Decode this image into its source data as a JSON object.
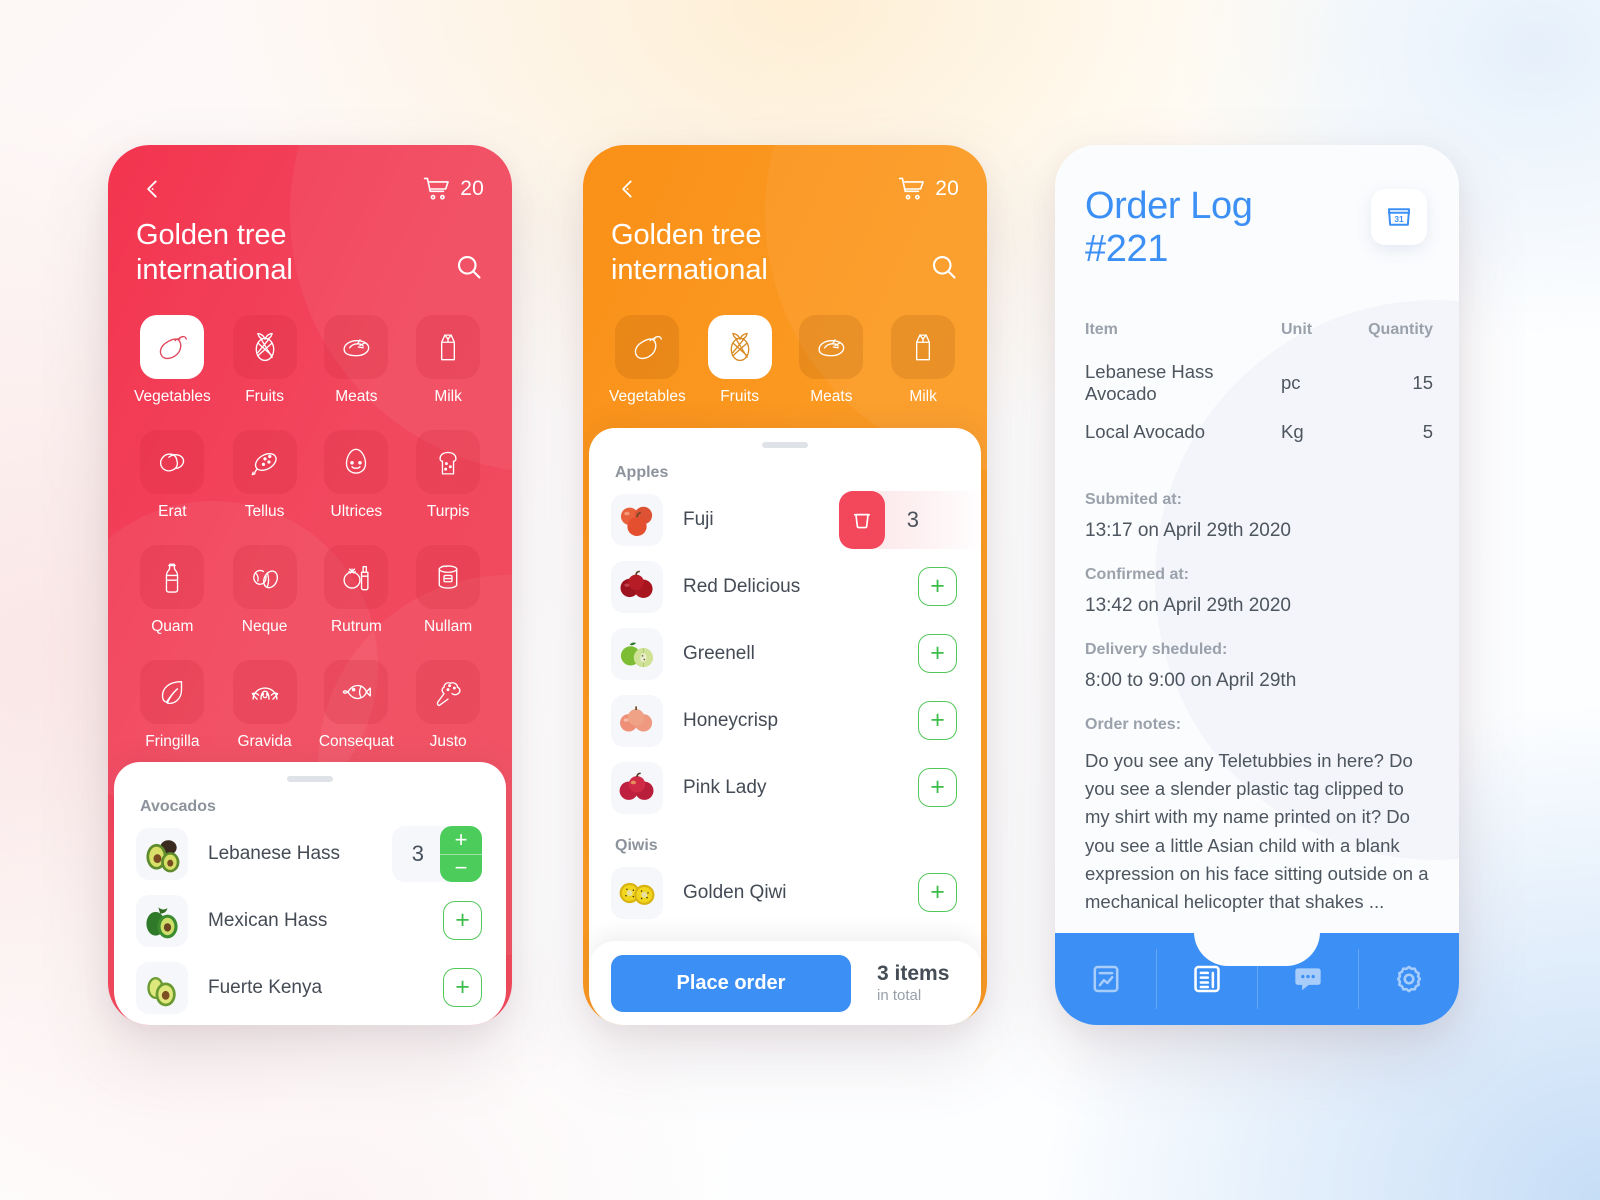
{
  "screens": {
    "catalog_red": {
      "theme_color": "#f2485e",
      "back_icon": "chevron-left-icon",
      "cart_icon": "shopping-cart-icon",
      "cart_count": "20",
      "store_name": "Golden tree international",
      "search_icon": "search-icon",
      "categories": [
        {
          "label": "Vegetables",
          "icon": "eggplant-icon",
          "active": true
        },
        {
          "label": "Fruits",
          "icon": "pineapple-icon",
          "active": false
        },
        {
          "label": "Meats",
          "icon": "steak-icon",
          "active": false
        },
        {
          "label": "Milk",
          "icon": "milk-carton-icon",
          "active": false
        },
        {
          "label": "Erat",
          "icon": "mango-icon",
          "active": false
        },
        {
          "label": "Tellus",
          "icon": "salami-icon",
          "active": false
        },
        {
          "label": "Ultrices",
          "icon": "egg-icon",
          "active": false
        },
        {
          "label": "Turpis",
          "icon": "bread-slice-icon",
          "active": false
        },
        {
          "label": "Quam",
          "icon": "soda-bottle-icon",
          "active": false
        },
        {
          "label": "Neque",
          "icon": "nuts-icon",
          "active": false
        },
        {
          "label": "Rutrum",
          "icon": "tomato-milk-icon",
          "active": false
        },
        {
          "label": "Nullam",
          "icon": "canned-food-icon",
          "active": false
        },
        {
          "label": "Fringilla",
          "icon": "leaf-icon",
          "active": false
        },
        {
          "label": "Gravida",
          "icon": "croissant-icon",
          "active": false
        },
        {
          "label": "Consequat",
          "icon": "fish-icon",
          "active": false
        },
        {
          "label": "Justo",
          "icon": "broccoli-icon",
          "active": false
        }
      ],
      "sheet": {
        "section_label": "Avocados",
        "items": [
          {
            "name": "Lebanese Hass",
            "thumb": "avocado-halved-dark-icon",
            "control": "stepper",
            "qty": "3"
          },
          {
            "name": "Mexican Hass",
            "thumb": "avocado-whole-green-icon",
            "control": "add"
          },
          {
            "name": "Fuerte Kenya",
            "thumb": "avocado-sliced-icon",
            "control": "add"
          }
        ],
        "add_label": "+",
        "plus_label": "+",
        "minus_label": "−"
      }
    },
    "catalog_orange": {
      "theme_color": "#fa9a22",
      "back_icon": "chevron-left-icon",
      "cart_icon": "shopping-cart-icon",
      "cart_count": "20",
      "store_name": "Golden tree international",
      "search_icon": "search-icon",
      "categories": [
        {
          "label": "Vegetables",
          "icon": "eggplant-icon",
          "active": false
        },
        {
          "label": "Fruits",
          "icon": "pineapple-icon",
          "active": true
        },
        {
          "label": "Meats",
          "icon": "steak-icon",
          "active": false
        },
        {
          "label": "Milk",
          "icon": "milk-carton-icon",
          "active": false
        }
      ],
      "sheet": {
        "groups": [
          {
            "section_label": "Apples",
            "items": [
              {
                "name": "Fuji",
                "thumb": "red-apples-icon",
                "control": "swipe-delete",
                "qty": "3",
                "delete_icon": "trash-icon"
              },
              {
                "name": "Red Delicious",
                "thumb": "dark-red-apples-icon",
                "control": "add"
              },
              {
                "name": "Greenell",
                "thumb": "green-apple-icon",
                "control": "add"
              },
              {
                "name": "Honeycrisp",
                "thumb": "honeycrisp-apples-icon",
                "control": "add"
              },
              {
                "name": "Pink Lady",
                "thumb": "pink-apples-icon",
                "control": "add"
              }
            ]
          },
          {
            "section_label": "Qiwis",
            "items": [
              {
                "name": "Golden Qiwi",
                "thumb": "golden-kiwi-icon",
                "control": "add"
              }
            ]
          }
        ],
        "add_label": "+"
      },
      "order_bar": {
        "place_order_label": "Place order",
        "total_count": "3 items",
        "total_suffix": "in total"
      }
    },
    "order_log": {
      "accent_color": "#3c90f5",
      "title": "Order Log #221",
      "title_line1": "Order Log",
      "title_line2": "#221",
      "calendar_icon": "calendar-31-icon",
      "table": {
        "headers": [
          "Item",
          "Unit",
          "Quantity"
        ],
        "rows": [
          [
            "Lebanese Hass Avocado",
            "pc",
            "15"
          ],
          [
            "Local Avocado",
            "Kg",
            "5"
          ]
        ]
      },
      "meta": [
        {
          "key": "Submited at:",
          "value": "13:17 on April 29th 2020"
        },
        {
          "key": "Confirmed at:",
          "value": "13:42 on April 29th 2020"
        },
        {
          "key": "Delivery sheduled:",
          "value": "8:00 to 9:00 on April 29th"
        }
      ],
      "notes_label": "Order notes:",
      "notes_text": "Do you see any Teletubbies in here? Do you see a slender plastic tag clipped to my shirt with my name printed on it? Do you see a little Asian child with a blank expression on his face sitting outside on a mechanical helicopter that shakes ...",
      "tabs": [
        {
          "icon": "report-chart-icon",
          "active": false
        },
        {
          "icon": "invoice-list-icon",
          "active": true
        },
        {
          "icon": "chat-bubble-icon",
          "active": false
        },
        {
          "icon": "settings-gear-icon",
          "active": false
        }
      ]
    }
  }
}
